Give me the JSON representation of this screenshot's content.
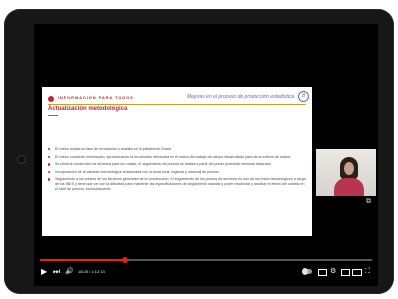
{
  "slide": {
    "tagline": "INFORMACIÓN PARA TODOS",
    "header_title": "Mejoras en el proceso de producción estadística",
    "badge": "8",
    "title": "Actualización metodológica",
    "bullets": [
      "El índice realiza su fase de recolección y análisis en la plataforma Oracle",
      "El índice consolidó información, aprovechando la recolección efectuada en el marco del trabajo de campo desarrollado para otros índices de costos.",
      "Se inicia la recolección de artículos para los cuales, el seguimiento de precios se realiza a partir del precio promedio mensual facturado.",
      "Incorporación de la variante metodológica relacionada con la toma local, regional y nacional de precios",
      "Seguimiento a los precios de los servicios generales de la construcción. El seguimiento de los precios de servicios es uno de los retos metodológicos a cargo de los INES y tiene que ver con la dificultad para mantener las especificaciones de seguimiento intactas y poder recolectar y analizar el efecto del cambio en el nivel de precios, exclusivamente."
    ]
  },
  "player": {
    "time": "18:25 / 1:12:13",
    "progress_fraction": 0.256
  },
  "icons": {
    "play": "play-icon",
    "next": "next-icon",
    "volume": "volume-icon",
    "autoplay": "autoplay-toggle",
    "subtitles": "subtitles-icon",
    "settings": "gear-icon",
    "miniplayer": "miniplayer-icon",
    "theater": "theater-icon",
    "fullscreen": "fullscreen-icon"
  },
  "colors": {
    "accent_red": "#c0262f",
    "progress_red": "#e62117",
    "title_blue": "#5a6fb0"
  }
}
